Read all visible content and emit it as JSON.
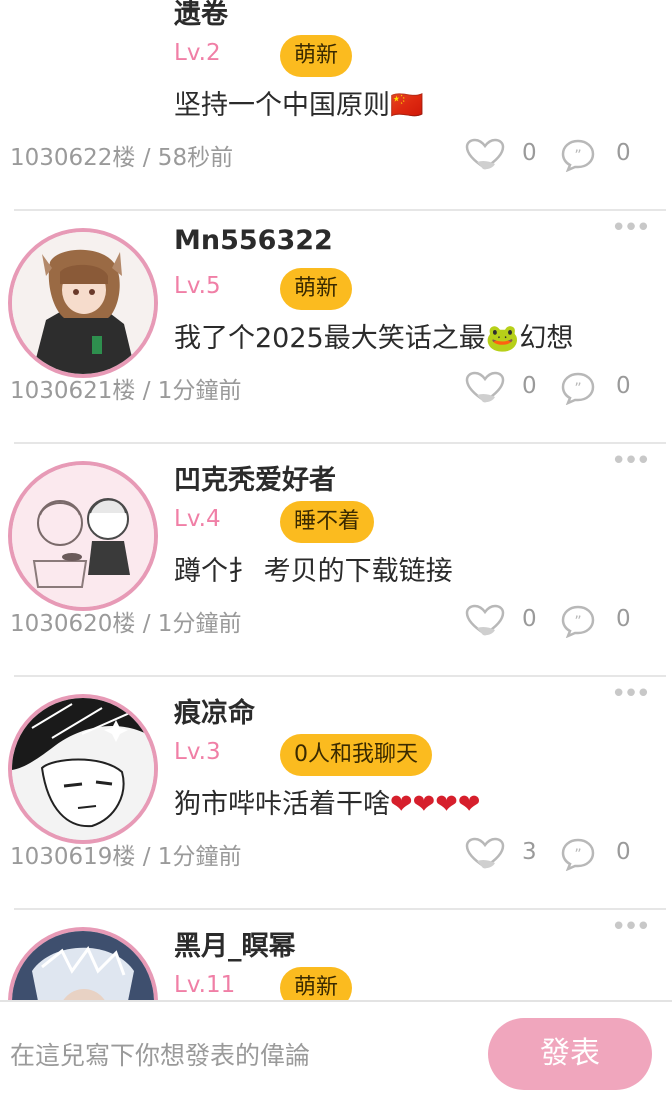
{
  "posts": [
    {
      "username": "遗卷",
      "level": "Lv.2",
      "badge": "萌新",
      "content": "坚持一个中国原则",
      "emoji": "🇨🇳",
      "meta": "1030622楼 / 58秒前",
      "likes": "0",
      "comments": "0",
      "more": "•••",
      "has_avatar": false
    },
    {
      "username": "Mn556322",
      "level": "Lv.5",
      "badge": "萌新",
      "content": "我了个2025最大笑话之最",
      "emoji": "🐸",
      "content_tail": "幻想",
      "meta": "1030621楼 / 1分鐘前",
      "likes": "0",
      "comments": "0",
      "more": "•••",
      "has_avatar": true
    },
    {
      "username": "凹克秃爱好者",
      "level": "Lv.4",
      "badge": "睡不着",
      "content": "蹲个扌 考贝的下载链接",
      "meta": "1030620楼 / 1分鐘前",
      "likes": "0",
      "comments": "0",
      "more": "•••",
      "has_avatar": true
    },
    {
      "username": "痕凉命",
      "level": "Lv.3",
      "badge": "0人和我聊天",
      "content": "狗市哔咔活着干啥",
      "emoji": "❤❤❤❤",
      "meta": "1030619楼 / 1分鐘前",
      "likes": "3",
      "comments": "0",
      "more": "•••",
      "has_avatar": true
    },
    {
      "username": "黑月_瞑幂",
      "level": "Lv.11",
      "badge": "萌新",
      "more": "•••",
      "has_avatar": true
    }
  ],
  "composer": {
    "placeholder": "在這兒寫下你想發表的偉論",
    "publish_label": "發表"
  },
  "colors": {
    "accent_pink": "#f07fa6",
    "badge_yellow": "#fbbb1f",
    "button_pink": "#f0a6bd"
  }
}
